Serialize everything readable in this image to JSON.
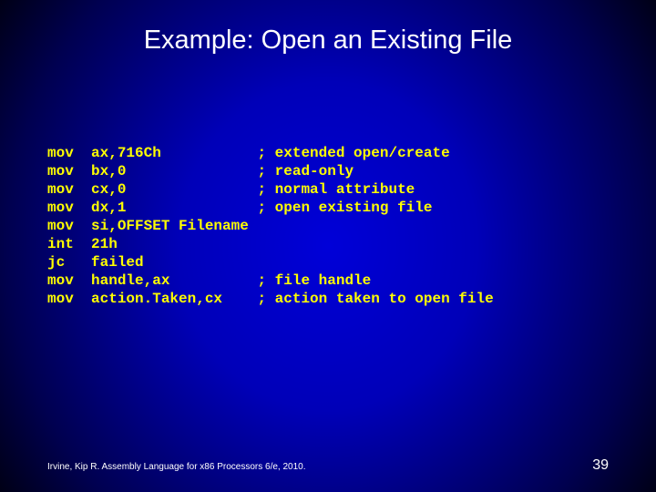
{
  "title": "Example: Open an Existing File",
  "code": "mov  ax,716Ch           ; extended open/create\nmov  bx,0               ; read-only\nmov  cx,0               ; normal attribute\nmov  dx,1               ; open existing file\nmov  si,OFFSET Filename\nint  21h\njc   failed\nmov  handle,ax          ; file handle\nmov  action.Taken,cx    ; action taken to open file",
  "footer": "Irvine, Kip R. Assembly Language for x86 Processors 6/e, 2010.",
  "page_number": "39"
}
